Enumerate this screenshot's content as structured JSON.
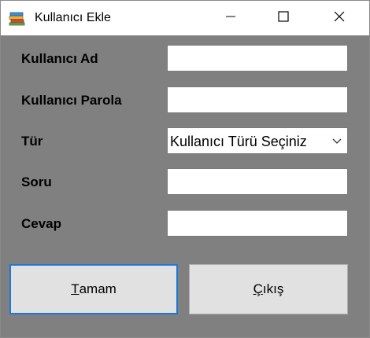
{
  "window": {
    "title": "Kullanıcı Ekle",
    "app_icon": "books-icon",
    "caption_buttons": [
      "minimize-icon",
      "maximize-icon",
      "close-icon"
    ]
  },
  "form": {
    "fields": [
      {
        "label": "Kullanıcı Ad",
        "value": ""
      },
      {
        "label": "Kullanıcı Parola",
        "value": ""
      },
      {
        "label": "Tür",
        "selected": "Kullanıcı Türü Seçiniz"
      },
      {
        "label": "Soru",
        "value": ""
      },
      {
        "label": "Cevap",
        "value": ""
      }
    ]
  },
  "buttons": {
    "ok": {
      "mnemonic": "T",
      "rest": "amam"
    },
    "exit": {
      "mnemonic": "Ç",
      "rest": "ıkış"
    }
  },
  "colors": {
    "client_background": "#808080",
    "focus_border": "#1e78d7",
    "button_face": "#e1e1e1"
  }
}
